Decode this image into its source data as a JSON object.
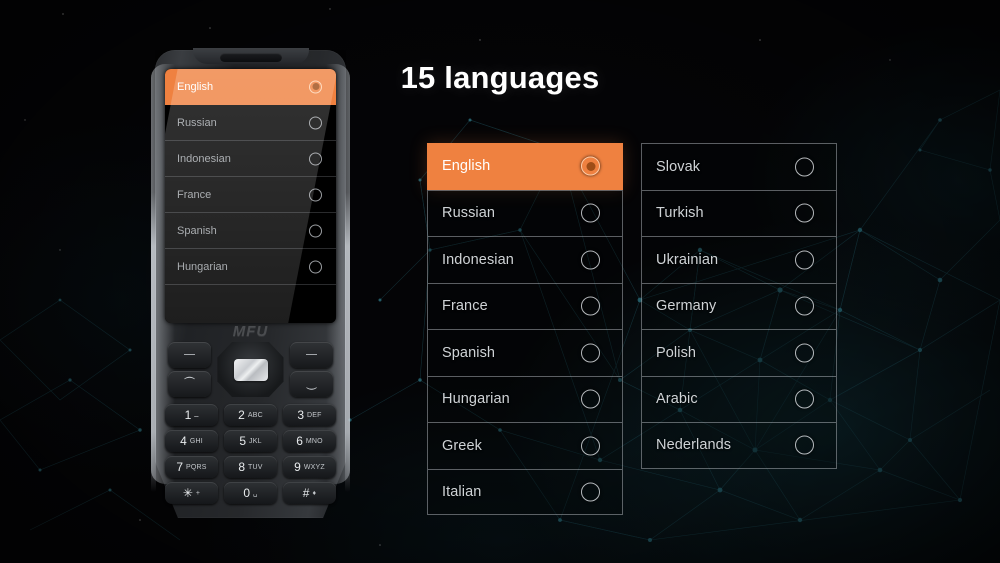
{
  "title": "15 languages",
  "colors": {
    "accent_orange": "#ef8140",
    "selected_dot": "#9e4d17",
    "background": "#040406",
    "mesh_teal": "#1d4f5a",
    "row_text": "#cfd3d6",
    "title_text": "#ffffff"
  },
  "language_panels": {
    "left_column": [
      {
        "label": "English",
        "selected": true,
        "radio": "radio-selected"
      },
      {
        "label": "Russian",
        "selected": false,
        "radio": "radio-unselected"
      },
      {
        "label": "Indonesian",
        "selected": false,
        "radio": "radio-unselected"
      },
      {
        "label": "France",
        "selected": false,
        "radio": "radio-unselected"
      },
      {
        "label": "Spanish",
        "selected": false,
        "radio": "radio-unselected"
      },
      {
        "label": "Hungarian",
        "selected": false,
        "radio": "radio-unselected"
      },
      {
        "label": "Greek",
        "selected": false,
        "radio": "radio-unselected"
      },
      {
        "label": "Italian",
        "selected": false,
        "radio": "radio-unselected"
      }
    ],
    "right_column": [
      {
        "label": "Slovak",
        "selected": false,
        "radio": "radio-unselected"
      },
      {
        "label": "Turkish",
        "selected": false,
        "radio": "radio-unselected"
      },
      {
        "label": "Ukrainian",
        "selected": false,
        "radio": "radio-unselected"
      },
      {
        "label": "Germany",
        "selected": false,
        "radio": "radio-unselected"
      },
      {
        "label": "Polish",
        "selected": false,
        "radio": "radio-unselected"
      },
      {
        "label": "Arabic",
        "selected": false,
        "radio": "radio-unselected"
      },
      {
        "label": "Nederlands",
        "selected": false,
        "radio": "radio-unselected"
      }
    ]
  },
  "phone": {
    "brand_logo": "MFU",
    "screen_rows": [
      {
        "label": "English",
        "selected": true
      },
      {
        "label": "Russian",
        "selected": false
      },
      {
        "label": "Indonesian",
        "selected": false
      },
      {
        "label": "France",
        "selected": false
      },
      {
        "label": "Spanish",
        "selected": false
      },
      {
        "label": "Hungarian",
        "selected": false
      }
    ],
    "soft_keys_left": [
      {
        "glyph": "—"
      },
      {
        "glyph": "⏜"
      }
    ],
    "soft_keys_right": [
      {
        "glyph": "—"
      },
      {
        "glyph": "⏝"
      }
    ],
    "dpad": "dpad-navigation-key",
    "keypad": [
      [
        {
          "digit": "1",
          "sub": "ــ"
        },
        {
          "digit": "2",
          "sub": "ABC"
        },
        {
          "digit": "3",
          "sub": "DEF"
        }
      ],
      [
        {
          "digit": "4",
          "sub": "GHI"
        },
        {
          "digit": "5",
          "sub": "JKL"
        },
        {
          "digit": "6",
          "sub": "MNO"
        }
      ],
      [
        {
          "digit": "7",
          "sub": "PQRS"
        },
        {
          "digit": "8",
          "sub": "TUV"
        },
        {
          "digit": "9",
          "sub": "WXYZ"
        }
      ],
      [
        {
          "digit": "✳",
          "sub": "+"
        },
        {
          "digit": "0",
          "sub": "␣"
        },
        {
          "digit": "#",
          "sub": "♦"
        }
      ]
    ]
  }
}
